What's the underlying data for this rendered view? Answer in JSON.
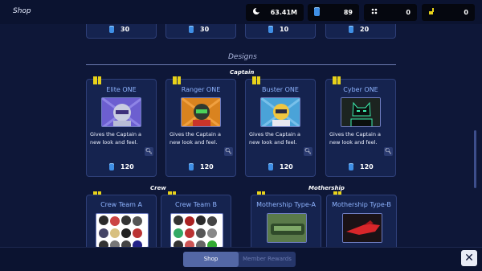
{
  "header": {
    "title": "Shop",
    "resources": [
      {
        "icon": "moon-icon",
        "value": "63.41M"
      },
      {
        "icon": "cell-icon",
        "value": "89"
      },
      {
        "icon": "dots-icon",
        "value": "0"
      },
      {
        "icon": "key-icon",
        "value": "0"
      }
    ]
  },
  "top_row_prices": [
    "30",
    "30",
    "10",
    "20"
  ],
  "designs": {
    "section_title": "Designs",
    "captain": {
      "title": "Captain",
      "items": [
        {
          "name": "Elite ONE",
          "desc": "Gives the Captain a new look and feel.",
          "price": "120"
        },
        {
          "name": "Ranger ONE",
          "desc": "Gives the Captain a new look and feel.",
          "price": "120"
        },
        {
          "name": "Buster ONE",
          "desc": "Gives the Captain a new look and feel.",
          "price": "120"
        },
        {
          "name": "Cyber ONE",
          "desc": "Gives the Captain a new look and feel.",
          "price": "120"
        }
      ]
    },
    "crew": {
      "title": "Crew",
      "items": [
        {
          "name": "Crew Team A"
        },
        {
          "name": "Crew Team B"
        }
      ]
    },
    "mothership": {
      "title": "Mothership",
      "items": [
        {
          "name": "Mothership Type-A"
        },
        {
          "name": "Mothership Type-B"
        }
      ]
    }
  },
  "tabs": {
    "shop": "Shop",
    "member_rewards": "Member Rewards"
  },
  "colors": {
    "background": "#0e1738",
    "card": "#15234f",
    "accent": "#8fb4ff",
    "flag": "#e8d21a"
  }
}
